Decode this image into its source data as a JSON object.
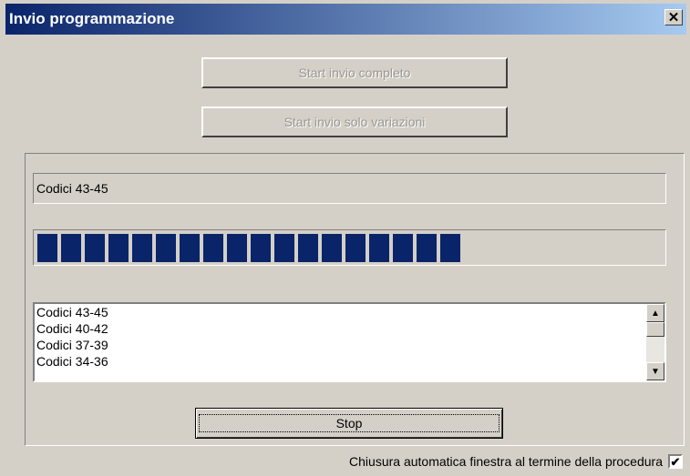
{
  "window": {
    "title": "Invio programmazione",
    "close_symbol": "✕"
  },
  "buttons": {
    "start_full": "Start invio completo",
    "start_variations": "Start invio solo variazioni",
    "stop": "Stop"
  },
  "status": {
    "text": "Codici 43-45"
  },
  "progress": {
    "fraction": 0.68,
    "segments_filled": 18
  },
  "log": {
    "items": [
      "Codici 43-45",
      "Codici 40-42",
      "Codici 37-39",
      "Codici 34-36"
    ]
  },
  "options": {
    "auto_close_label": "Chiusura automatica finestra al termine della procedura",
    "auto_close_checked": true,
    "check_mark": "✔"
  },
  "colors": {
    "titlebar_start": "#0a246a",
    "titlebar_end": "#a6caf0",
    "progress_fill": "#0a246a",
    "face": "#d4d0c8"
  }
}
